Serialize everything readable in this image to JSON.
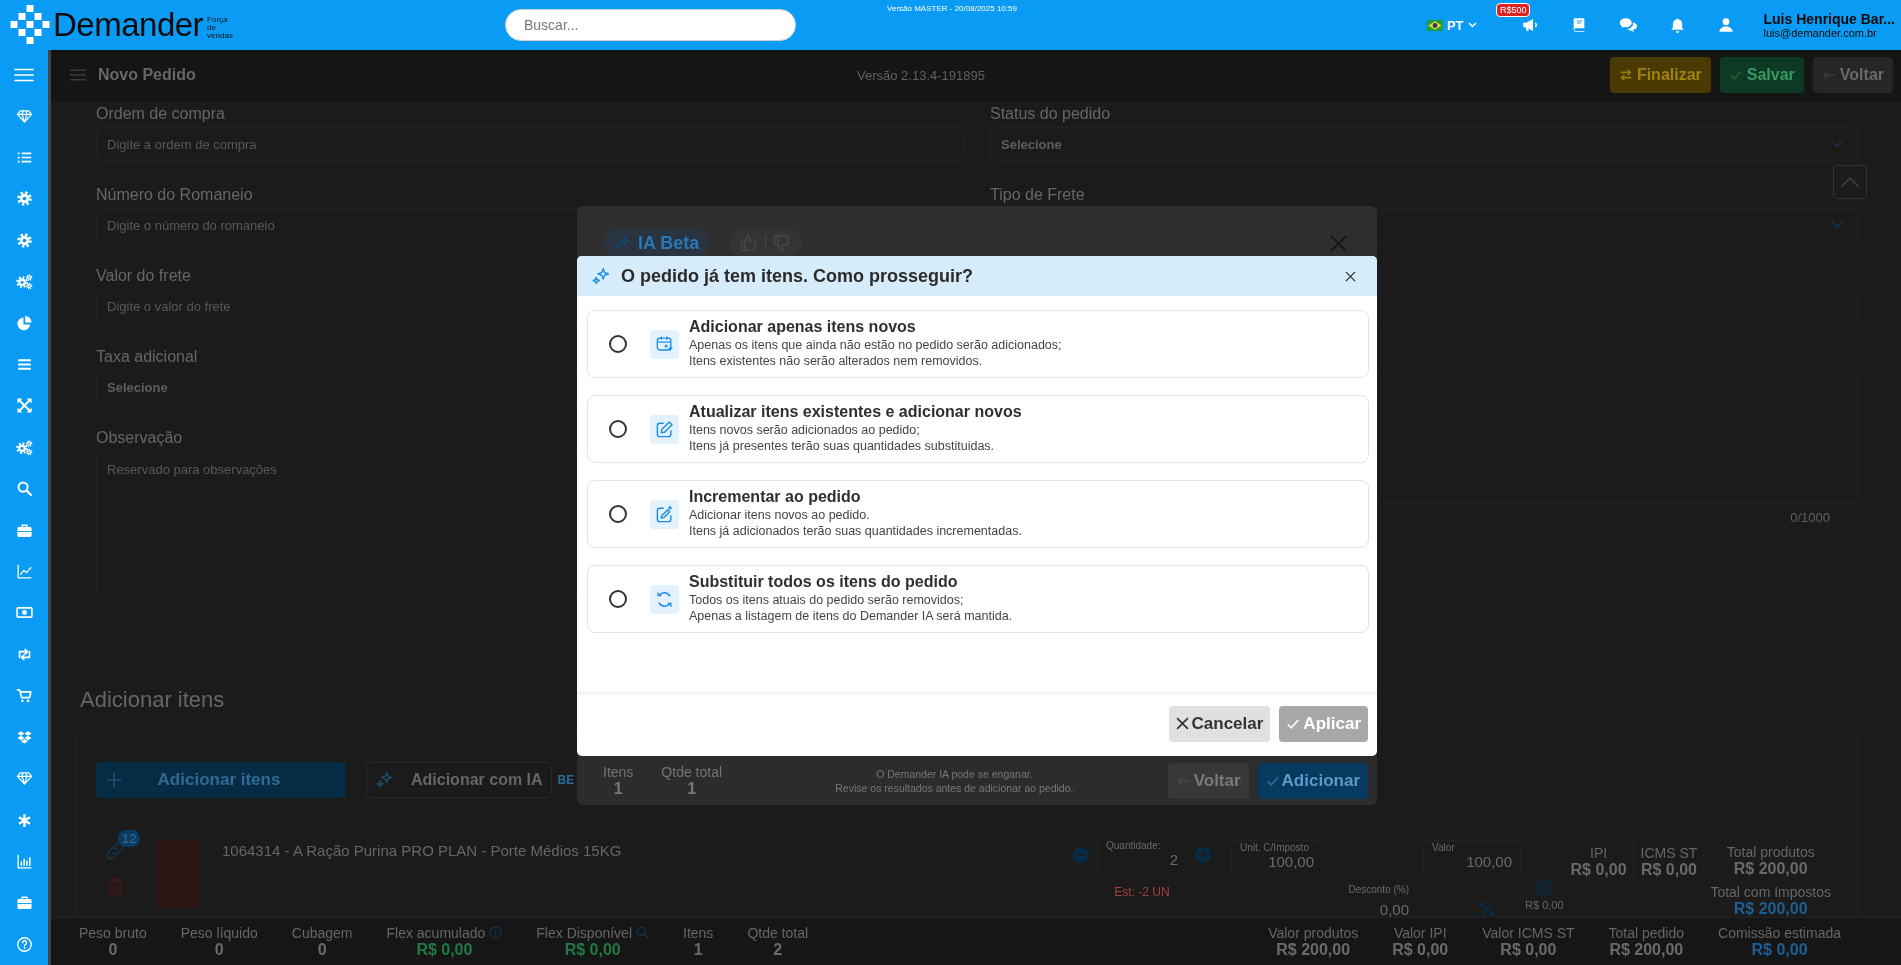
{
  "topbar": {
    "logo": "Demander",
    "tagline": "Força de vendas",
    "search": {
      "placeholder": "Buscar..."
    },
    "build": "Versão MASTER - 20/08/2025 10:59",
    "language": "PT",
    "announcement_badge": "R$500",
    "user": {
      "name": "Luis Henrique Bar...",
      "email": "luis@demander.com.br"
    }
  },
  "page": {
    "title": "Novo Pedido",
    "version": "Versão 2.13.4-191895",
    "actions": [
      {
        "label": "Finalizar",
        "kind": "finish"
      },
      {
        "label": "Salvar",
        "kind": "save"
      },
      {
        "label": "Voltar",
        "kind": "back"
      }
    ]
  },
  "form": {
    "left": [
      {
        "label": "Ordem de compra",
        "placeholder": "Digite a ordem de compra",
        "kind": "input"
      },
      {
        "label": "Número do Romaneio",
        "placeholder": "Digite o número do romaneio",
        "kind": "input"
      },
      {
        "label": "Valor do frete",
        "placeholder": "Digite o valor do frete",
        "kind": "input"
      },
      {
        "label": "Taxa adicional",
        "value": "Selecione",
        "kind": "select"
      },
      {
        "label": "Observação",
        "placeholder": "Reservado para observações",
        "kind": "textarea"
      }
    ],
    "right": [
      {
        "label": "Status do pedido",
        "value": "Selecione",
        "kind": "select"
      },
      {
        "label": "Tipo de Frete",
        "kind": "select"
      },
      {
        "kind": "input"
      },
      {
        "kind": "textarea",
        "counter": "0/1000"
      }
    ]
  },
  "items_section": {
    "title": "Adicionar itens",
    "add_button": "Adicionar itens",
    "ai_button": "Adicionar com IA",
    "ai_badge": "BE",
    "items": [
      {
        "title": "1064314 - A Ração Purina PRO PLAN - Porte Médios 15KG",
        "link_count": "12",
        "quantity": {
          "label": "Quantidade:",
          "value": "2"
        },
        "stock": "Est: -2 UN",
        "unit_price": {
          "label": "Unit. C/Imposto",
          "value": "100,00"
        },
        "discount": {
          "label": "Desconto (%)",
          "value": "0,00"
        },
        "price": {
          "label": "Valor",
          "value": "100,00"
        },
        "flex_value": "R$ 0,00",
        "totals": [
          {
            "label": "IPI",
            "value": "R$ 0,00"
          },
          {
            "label": "ICMS ST",
            "value": "R$ 0,00"
          },
          {
            "label": "Total produtos",
            "value": "R$ 200,00"
          }
        ],
        "total_with_taxes": {
          "label": "Total com Impostos",
          "value": "R$ 200,00"
        }
      }
    ]
  },
  "summary": [
    {
      "label": "Peso bruto",
      "value": "0",
      "kind": "plain"
    },
    {
      "label": "Peso líquido",
      "value": "0",
      "kind": "plain"
    },
    {
      "label": "Cubagem",
      "value": "0",
      "kind": "plain"
    },
    {
      "label": "Flex acumulado",
      "value": "R$ 0,00",
      "kind": "accumulated"
    },
    {
      "label": "Flex Disponível",
      "value": "R$ 0,00",
      "kind": "available"
    },
    {
      "label": "Itens",
      "value": "1",
      "kind": "plain"
    },
    {
      "label": "Qtde total",
      "value": "2",
      "kind": "plain"
    },
    {
      "label": "Valor produtos",
      "value": "R$ 200,00",
      "kind": "plain"
    },
    {
      "label": "Valor IPI",
      "value": "R$ 0,00",
      "kind": "plain"
    },
    {
      "label": "Valor ICMS ST",
      "value": "R$ 0,00",
      "kind": "plain"
    },
    {
      "label": "Total pedido",
      "value": "R$ 200,00",
      "kind": "plain"
    },
    {
      "label": "Comissão estimada",
      "value": "R$ 0,00",
      "kind": "commission"
    }
  ],
  "ai_modal": {
    "badge": "IA Beta",
    "stats": [
      {
        "label": "Itens",
        "value": "1"
      },
      {
        "label": "Qtde total",
        "value": "1"
      }
    ],
    "disclaimer": [
      "O Demander IA pode se enganar.",
      "Revise os resultados antes de adicionar ao pedido."
    ],
    "buttons": [
      {
        "label": "Voltar",
        "kind": "back"
      },
      {
        "label": "Adicionar",
        "kind": "primary"
      }
    ]
  },
  "dialog": {
    "title": "O pedido já tem itens. Como prosseguir?",
    "options": [
      {
        "kind": "add",
        "title": "Adicionar apenas itens novos",
        "description": [
          "Apenas os itens que ainda não estão no pedido serão adicionados;",
          "Itens existentes não serão alterados nem removidos."
        ],
        "selected": false
      },
      {
        "kind": "update",
        "title": "Atualizar itens existentes e adicionar novos",
        "description": [
          "Itens novos serão adicionados ao pedido;",
          "Itens já presentes terão suas quantidades substituidas."
        ],
        "selected": false
      },
      {
        "kind": "increment",
        "title": "Incrementar ao pedido",
        "description": [
          "Adicionar itens novos ao pedido.",
          "Itens já adicionados terão suas quantidades incrementadas."
        ],
        "selected": false
      },
      {
        "kind": "replace",
        "title": "Substituir todos os itens do pedido",
        "description": [
          "Todos os itens atuais do pedido serão removidos;",
          "Apenas a listagem de itens do Demander IA será mantida."
        ],
        "selected": false
      }
    ],
    "buttons": [
      {
        "label": "Cancelar",
        "kind": "cancel",
        "disabled": false
      },
      {
        "label": "Aplicar",
        "kind": "apply",
        "disabled": true
      }
    ]
  }
}
